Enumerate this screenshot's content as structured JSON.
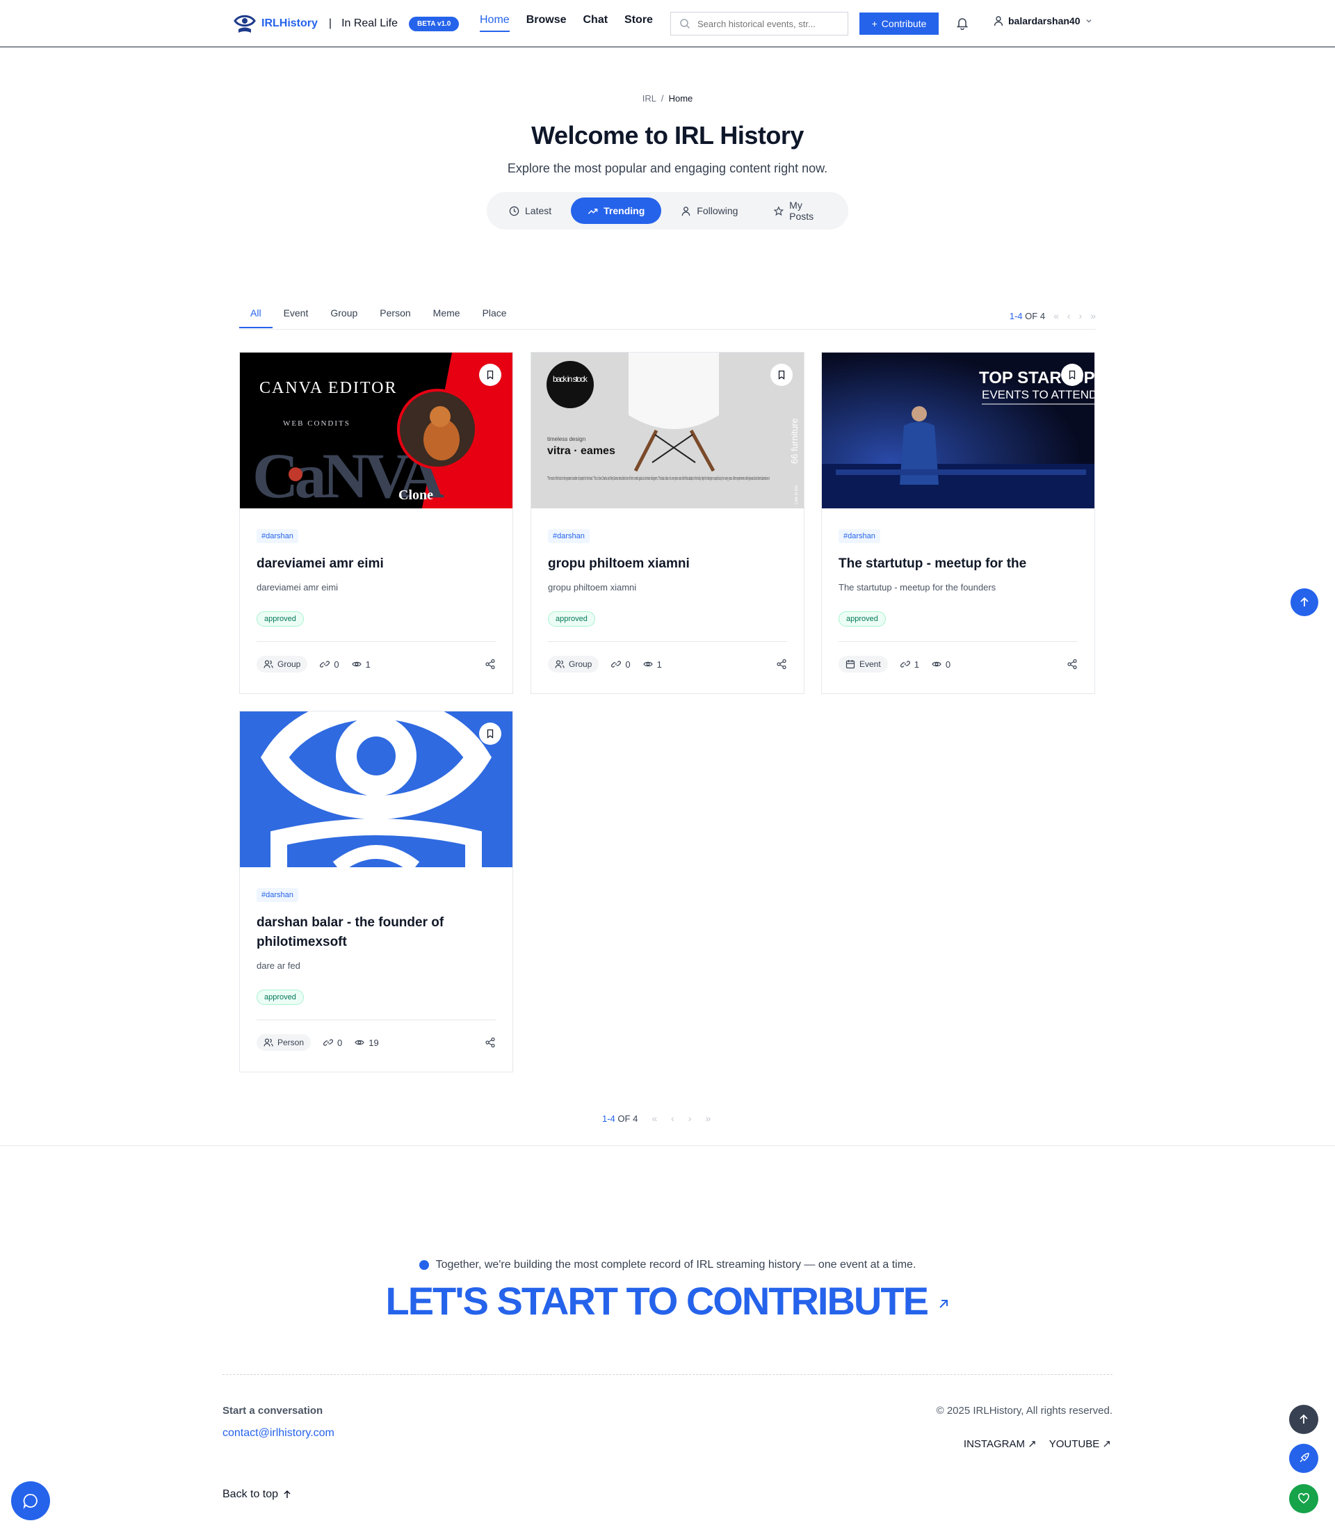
{
  "header": {
    "brand_name": "IRLHistory",
    "separator": "|",
    "subtitle": "In Real Life",
    "beta_badge": "BETA v1.0",
    "nav": [
      {
        "label": "Home",
        "active": true
      },
      {
        "label": "Browse",
        "active": false
      },
      {
        "label": "Chat",
        "active": false
      },
      {
        "label": "Store",
        "active": false
      }
    ],
    "search_placeholder": "Search historical events, str...",
    "contribute_label": "Contribute",
    "username": "balardarshan40"
  },
  "hero": {
    "breadcrumb_root": "IRL",
    "breadcrumb_sep": "/",
    "breadcrumb_current": "Home",
    "title": "Welcome to IRL History",
    "subtitle": "Explore the most popular and engaging content right now.",
    "feed_tabs": [
      {
        "label": "Latest",
        "icon": "clock-icon",
        "active": false
      },
      {
        "label": "Trending",
        "icon": "trending-icon",
        "active": true
      },
      {
        "label": "Following",
        "icon": "user-icon",
        "active": false
      },
      {
        "label": "My Posts",
        "icon": "star-icon",
        "active": false
      }
    ]
  },
  "categories": [
    "All",
    "Event",
    "Group",
    "Person",
    "Meme",
    "Place"
  ],
  "active_category": "All",
  "pagination": {
    "range": "1-4",
    "of_label": "OF 4"
  },
  "cards": [
    {
      "image_text": {
        "top": "CANVA EDITOR",
        "sub": "WEB CONDITS",
        "big": "CaNVA",
        "corner": "Clone"
      },
      "tag": "#darshan",
      "title": "dareviamei amr eimi",
      "description": "dareviamei amr eimi",
      "status": "approved",
      "type": "Group",
      "type_icon": "users-icon",
      "links": "0",
      "views": "1"
    },
    {
      "image_text": {
        "badge": "back in stock",
        "small": "timeless design",
        "brand": "vitra · eames",
        "side": "66 furniture",
        "side_small": "Link in bio",
        "body": "\"The most of the best to the greatest number of people for the least.\" This is how Charles and Ray Eames described one of their central goals as furniture designers. The basic idea of a one-piece seat shell that adapts to the body kept the designer couple busy for many years. After experiments with plywood and sheet aluminum in"
      },
      "tag": "#darshan",
      "title": "gropu philtoem xiamni",
      "description": "gropu philtoem xiamni",
      "status": "approved",
      "type": "Group",
      "type_icon": "users-icon",
      "links": "0",
      "views": "1"
    },
    {
      "image_text": {
        "line1": "TOP STARTUP",
        "line2": "EVENTS TO ATTEND"
      },
      "tag": "#darshan",
      "title": "The startutup - meetup for the",
      "description": "The startutup - meetup for the founders",
      "status": "approved",
      "type": "Event",
      "type_icon": "calendar-icon",
      "links": "1",
      "views": "0"
    },
    {
      "image_text": {},
      "tag": "#darshan",
      "title": "darshan balar - the founder of philotimexsoft",
      "description": "dare ar fed",
      "status": "approved",
      "type": "Person",
      "type_icon": "users-icon",
      "links": "0",
      "views": "19"
    }
  ],
  "footer": {
    "note": "Together, we're building the most complete record of IRL streaming history — one event at a time.",
    "cta": "LET'S START TO CONTRIBUTE",
    "conversation_label": "Start a conversation",
    "email": "contact@irlhistory.com",
    "copyright": "© 2025 IRLHistory, All rights reserved.",
    "socials": [
      "INSTAGRAM",
      "YOUTUBE"
    ],
    "back_to_top": "Back to top"
  },
  "colors": {
    "accent": "#2563eb",
    "text": "#111827",
    "muted": "#6b7280",
    "approved": "#047857",
    "canva_red": "#e60012",
    "fab_green": "#16a34a",
    "fab_dark": "#374151"
  }
}
